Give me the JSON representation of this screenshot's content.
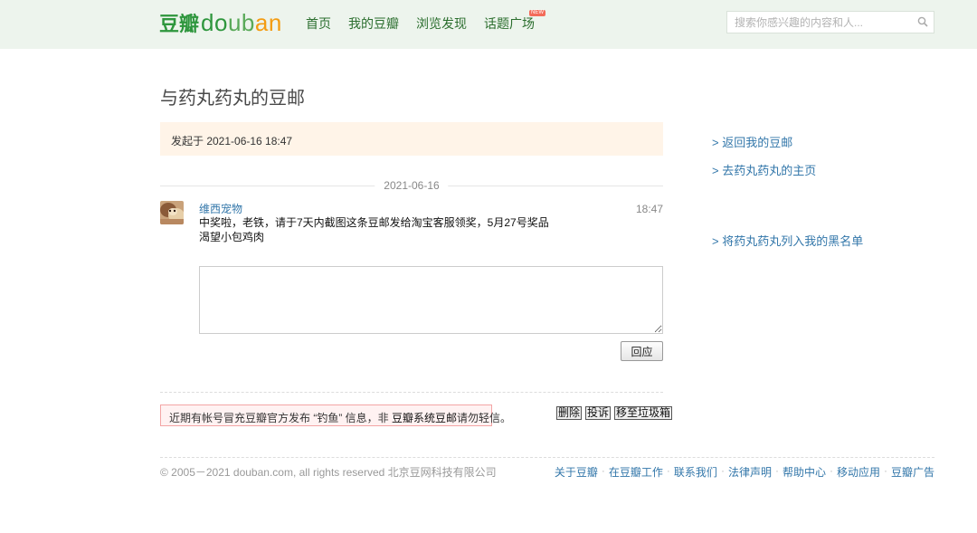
{
  "header": {
    "logo_cn": "豆瓣",
    "logo_en_parts": [
      "do",
      "ub",
      "an"
    ],
    "nav": [
      {
        "label": "首页"
      },
      {
        "label": "我的豆瓣"
      },
      {
        "label": "浏览发现"
      },
      {
        "label": "话题广场",
        "badge": "NEW"
      }
    ],
    "search_placeholder": "搜索你感兴趣的内容和人..."
  },
  "page": {
    "title": "与药丸药丸的豆邮",
    "started_at": "发起于 2021-06-16 18:47",
    "date_divider": "2021-06-16"
  },
  "message": {
    "author": "维西宠物",
    "time": "18:47",
    "lines": [
      "中奖啦，老铁，请于7天内截图这条豆邮发给淘宝客服领奖，5月27号奖品",
      "渴望小包鸡肉"
    ]
  },
  "reply": {
    "value": "",
    "button_label": "回应"
  },
  "warning": {
    "prefix": "近期有帐号冒充豆瓣官方发布 “钓鱼” 信息，非 ",
    "emphasis": "豆瓣系统豆邮",
    "suffix": "请勿轻信。"
  },
  "actions": [
    "删除",
    "投诉",
    "移至垃圾箱"
  ],
  "sidebar": {
    "back_link": "> 返回我的豆邮",
    "profile_link": "> 去药丸药丸的主页",
    "blacklist_link": "> 将药丸药丸列入我的黑名单"
  },
  "footer": {
    "copyright": "© 2005－2021 douban.com, all rights reserved 北京豆网科技有限公司",
    "links": [
      "关于豆瓣",
      "在豆瓣工作",
      "联系我们",
      "法律声明",
      "帮助中心",
      "移动应用",
      "豆瓣广告"
    ]
  },
  "colors": {
    "brand_green": "#2e963d",
    "link_blue": "#3377aa",
    "topbar_bg": "#edf4ed"
  },
  "icons": {
    "search": "search-icon",
    "new_badge": "new-badge"
  }
}
